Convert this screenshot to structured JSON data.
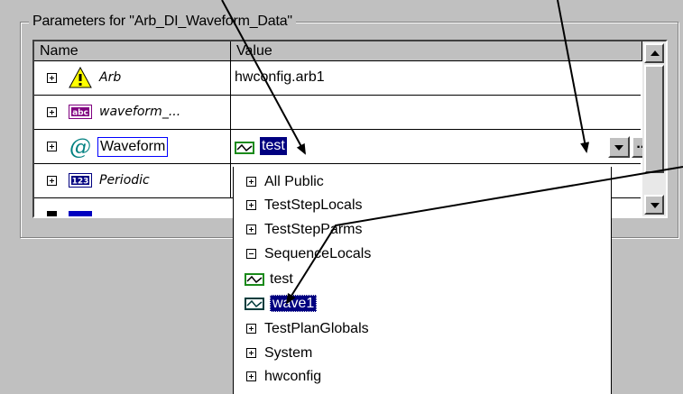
{
  "panel": {
    "title": "Parameters for \"Arb_DI_Waveform_Data\""
  },
  "grid": {
    "columns": [
      "Name",
      "Value"
    ],
    "rows": [
      {
        "name": "Arb",
        "value": "hwconfig.arb1",
        "icon": "warning-icon"
      },
      {
        "name": "waveform_...",
        "value": "",
        "icon": "abc-icon"
      },
      {
        "name": "Waveform",
        "value": "test",
        "icon": "at-icon"
      },
      {
        "name": "Periodic",
        "value": "",
        "icon": "123-icon"
      }
    ]
  },
  "waveform_field": {
    "value": "test",
    "browse_label": "..."
  },
  "dropdown": {
    "items": [
      {
        "label": "All Public",
        "type": "group"
      },
      {
        "label": "TestStepLocals",
        "type": "group"
      },
      {
        "label": "TestStepParms",
        "type": "group"
      },
      {
        "label": "SequenceLocals",
        "type": "group-open"
      },
      {
        "label": "test",
        "type": "waveform"
      },
      {
        "label": "wave1",
        "type": "waveform-selected"
      },
      {
        "label": "TestPlanGlobals",
        "type": "group"
      },
      {
        "label": "System",
        "type": "group"
      },
      {
        "label": "hwconfig",
        "type": "group"
      }
    ]
  },
  "colors": {
    "dialog_bg": "#c0c0c0",
    "selection": "#000080",
    "waveform_icon": "#1a8a1a",
    "warning_yellow": "#ffff00",
    "abc_purple": "#800080",
    "number_blue": "#000080"
  }
}
